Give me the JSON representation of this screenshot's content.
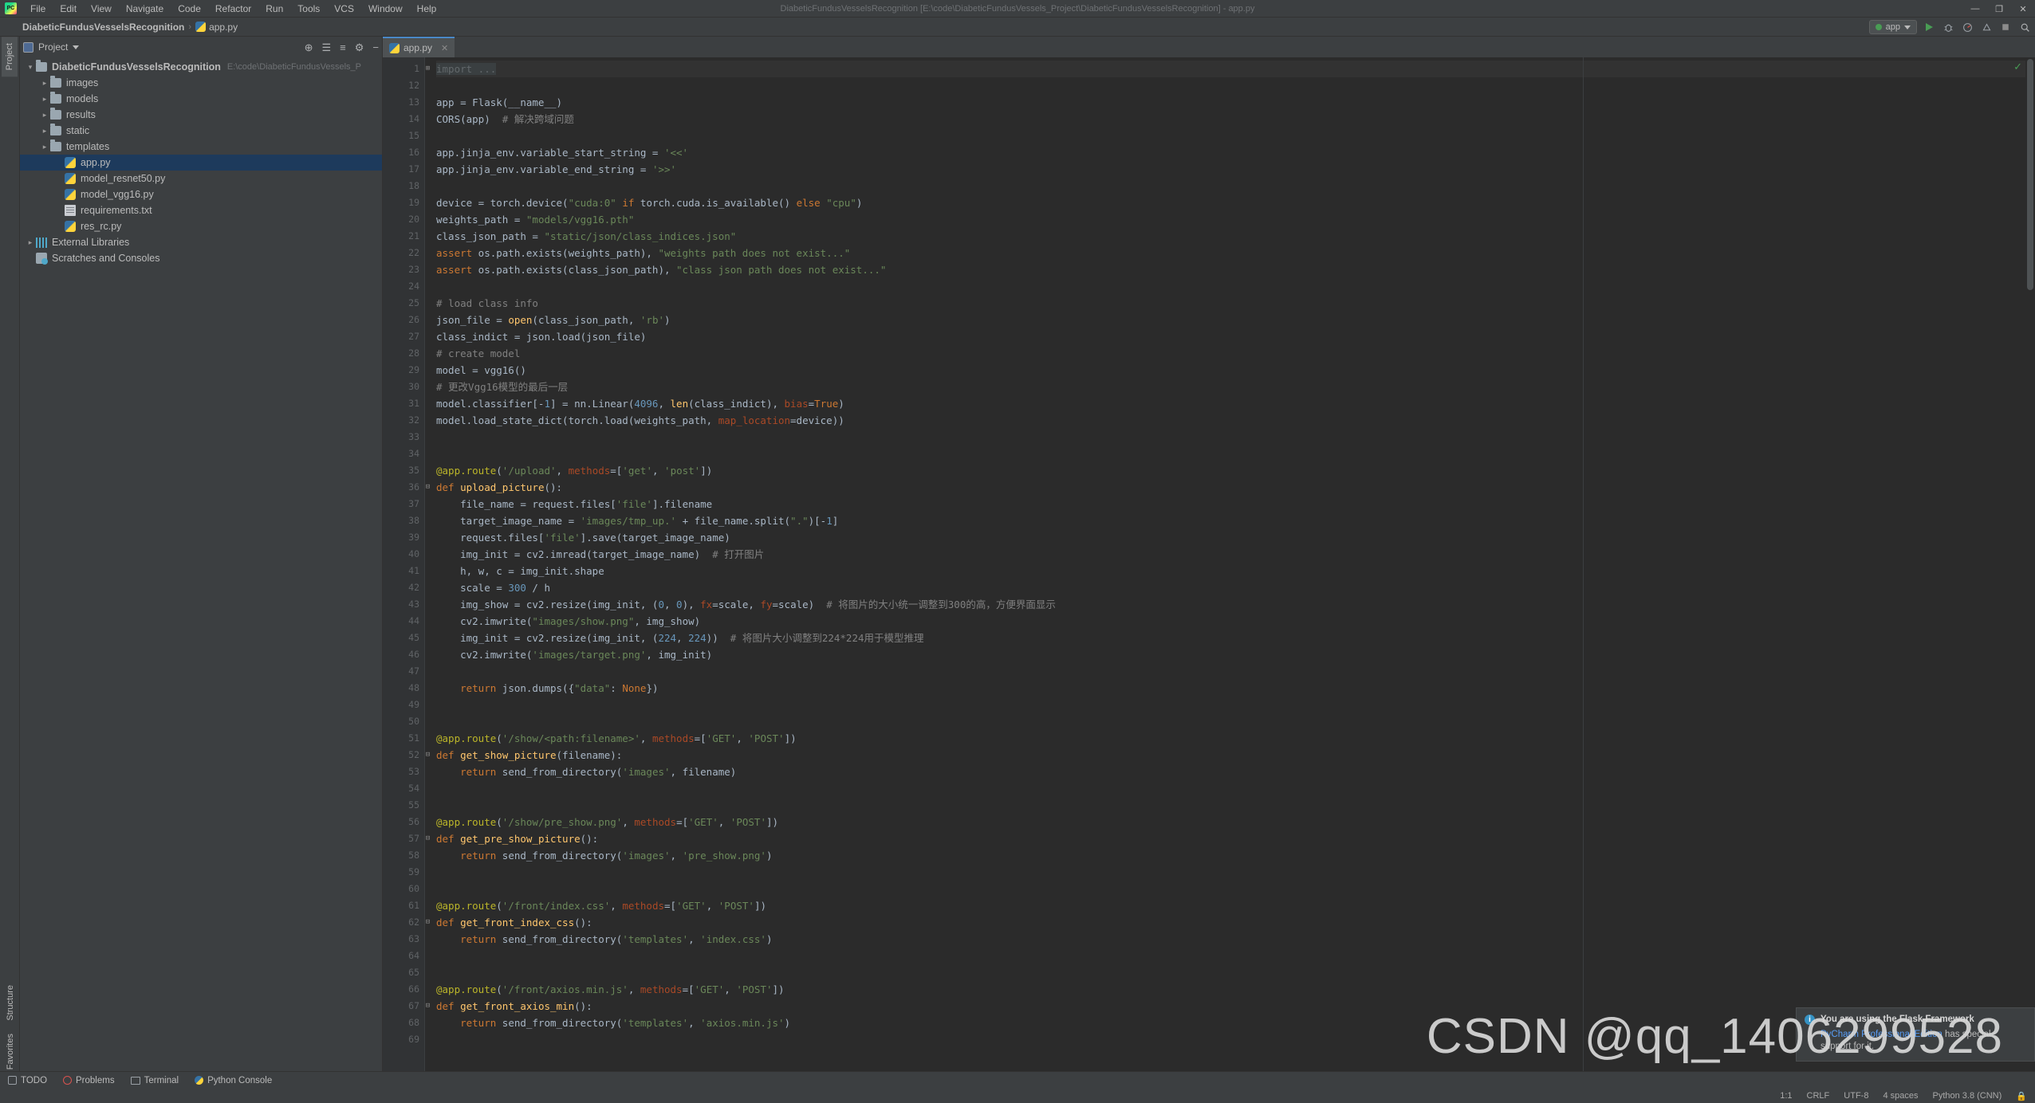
{
  "window": {
    "title": "DiabeticFundusVesselsRecognition [E:\\code\\DiabeticFundusVessels_Project\\DiabeticFundusVesselsRecognition] - app.py",
    "minimize": "—",
    "maximize": "❐",
    "close": "✕"
  },
  "menubar": {
    "items": [
      "File",
      "Edit",
      "View",
      "Navigate",
      "Code",
      "Refactor",
      "Run",
      "Tools",
      "VCS",
      "Window",
      "Help"
    ]
  },
  "breadcrumb": {
    "project": "DiabeticFundusVesselsRecognition",
    "separator": "›",
    "file": "app.py"
  },
  "runwidget": {
    "config_name": "app",
    "run_icon": "run-icon",
    "debug_icon": "debug-icon",
    "profile_icon": "profile-icon",
    "coverage_icon": "coverage-icon",
    "stop_icon": "stop-icon",
    "search_icon": "search-icon"
  },
  "left_strip": {
    "project_tab": "Project",
    "structure_tab": "Structure",
    "favorites_tab": "Favorites"
  },
  "project_panel": {
    "title": "Project",
    "tools": [
      "⊕",
      "☰",
      "≡",
      "⚙",
      "−"
    ],
    "tree": [
      {
        "depth": 0,
        "arrow": "open",
        "icon": "folder",
        "label": "DiabeticFundusVesselsRecognition",
        "bold": true,
        "path": "E:\\code\\DiabeticFundusVessels_P",
        "selected": false
      },
      {
        "depth": 1,
        "arrow": "closed",
        "icon": "folder",
        "label": "images",
        "bold": false,
        "path": "",
        "selected": false
      },
      {
        "depth": 1,
        "arrow": "closed",
        "icon": "folder",
        "label": "models",
        "bold": false,
        "path": "",
        "selected": false
      },
      {
        "depth": 1,
        "arrow": "closed",
        "icon": "folder",
        "label": "results",
        "bold": false,
        "path": "",
        "selected": false
      },
      {
        "depth": 1,
        "arrow": "closed",
        "icon": "folder",
        "label": "static",
        "bold": false,
        "path": "",
        "selected": false
      },
      {
        "depth": 1,
        "arrow": "closed",
        "icon": "folder",
        "label": "templates",
        "bold": false,
        "path": "",
        "selected": false
      },
      {
        "depth": 2,
        "arrow": "none",
        "icon": "py",
        "label": "app.py",
        "bold": false,
        "path": "",
        "selected": true
      },
      {
        "depth": 2,
        "arrow": "none",
        "icon": "py",
        "label": "model_resnet50.py",
        "bold": false,
        "path": "",
        "selected": false
      },
      {
        "depth": 2,
        "arrow": "none",
        "icon": "py",
        "label": "model_vgg16.py",
        "bold": false,
        "path": "",
        "selected": false
      },
      {
        "depth": 2,
        "arrow": "none",
        "icon": "txt",
        "label": "requirements.txt",
        "bold": false,
        "path": "",
        "selected": false
      },
      {
        "depth": 2,
        "arrow": "none",
        "icon": "py",
        "label": "res_rc.py",
        "bold": false,
        "path": "",
        "selected": false
      },
      {
        "depth": 0,
        "arrow": "closed",
        "icon": "lib",
        "label": "External Libraries",
        "bold": false,
        "path": "",
        "selected": false
      },
      {
        "depth": 0,
        "arrow": "none",
        "icon": "scratch",
        "label": "Scratches and Consoles",
        "bold": false,
        "path": "",
        "selected": false
      }
    ]
  },
  "editor": {
    "tab_label": "app.py",
    "tab_close": "✕",
    "first_line_number": 1,
    "lines": [
      {
        "n": 1,
        "fold": "+",
        "html": "<span class=\"fold-text\">import ...</span>"
      },
      {
        "n": 12,
        "fold": "",
        "html": ""
      },
      {
        "n": 13,
        "fold": "",
        "html": "app = Flask(__name__)"
      },
      {
        "n": 14,
        "fold": "",
        "html": "CORS(app)  <span class=\"cmt\"># 解决跨域问题</span>"
      },
      {
        "n": 15,
        "fold": "",
        "html": ""
      },
      {
        "n": 16,
        "fold": "",
        "html": "app.jinja_env.variable_start_string = <span class=\"str\">'&lt;&lt;'</span>"
      },
      {
        "n": 17,
        "fold": "",
        "html": "app.jinja_env.variable_end_string = <span class=\"str\">'&gt;&gt;'</span>"
      },
      {
        "n": 18,
        "fold": "",
        "html": ""
      },
      {
        "n": 19,
        "fold": "",
        "html": "device = torch.device(<span class=\"str\">\"cuda:0\"</span> <span class=\"kw\">if</span> torch.cuda.is_available() <span class=\"kw\">else</span> <span class=\"str\">\"cpu\"</span>)"
      },
      {
        "n": 20,
        "fold": "",
        "html": "weights_path = <span class=\"str\">\"models/vgg16.pth\"</span>"
      },
      {
        "n": 21,
        "fold": "",
        "html": "class_json_path = <span class=\"str\">\"static/json/class_indices.json\"</span>"
      },
      {
        "n": 22,
        "fold": "",
        "html": "<span class=\"kw\">assert</span> os.path.exists(weights_path), <span class=\"str\">\"weights path does not exist...\"</span>"
      },
      {
        "n": 23,
        "fold": "",
        "html": "<span class=\"kw\">assert</span> os.path.exists(class_json_path), <span class=\"str\">\"class json path does not exist...\"</span>"
      },
      {
        "n": 24,
        "fold": "",
        "html": ""
      },
      {
        "n": 25,
        "fold": "",
        "html": "<span class=\"cmt\"># load class info</span>"
      },
      {
        "n": 26,
        "fold": "",
        "html": "json_file = <span class=\"fn\">open</span>(class_json_path, <span class=\"str\">'rb'</span>)"
      },
      {
        "n": 27,
        "fold": "",
        "html": "class_indict = json.load(json_file)"
      },
      {
        "n": 28,
        "fold": "",
        "html": "<span class=\"cmt\"># create model</span>"
      },
      {
        "n": 29,
        "fold": "",
        "html": "model = vgg16()"
      },
      {
        "n": 30,
        "fold": "",
        "html": "<span class=\"cmt\"># 更改Vgg16模型的最后一层</span>"
      },
      {
        "n": 31,
        "fold": "",
        "html": "model.classifier[-<span class=\"num\">1</span>] = nn.Linear(<span class=\"num\">4096</span>, <span class=\"fn\">len</span>(class_indict), <span class=\"param\">bias</span>=<span class=\"kw\">True</span>)"
      },
      {
        "n": 32,
        "fold": "",
        "html": "model.load_state_dict(torch.load(weights_path, <span class=\"param\">map_location</span>=device))"
      },
      {
        "n": 33,
        "fold": "",
        "html": ""
      },
      {
        "n": 34,
        "fold": "",
        "html": ""
      },
      {
        "n": 35,
        "fold": "",
        "html": "<span class=\"dec\">@app.route</span>(<span class=\"str\">'/upload'</span>, <span class=\"param\">methods</span>=[<span class=\"str\">'get'</span>, <span class=\"str\">'post'</span>])"
      },
      {
        "n": 36,
        "fold": "-",
        "html": "<span class=\"kw\">def</span> <span class=\"fn\">upload_picture</span>():"
      },
      {
        "n": 37,
        "fold": "",
        "html": "    file_name = request.files[<span class=\"str\">'file'</span>].filename"
      },
      {
        "n": 38,
        "fold": "",
        "html": "    target_image_name = <span class=\"str\">'images/tmp_up.'</span> + file_name.split(<span class=\"str\">\".\"</span>)[-<span class=\"num\">1</span>]"
      },
      {
        "n": 39,
        "fold": "",
        "html": "    request.files[<span class=\"str\">'file'</span>].save(target_image_name)"
      },
      {
        "n": 40,
        "fold": "",
        "html": "    img_init = cv2.imread(target_image_name)  <span class=\"cmt\"># 打开图片</span>"
      },
      {
        "n": 41,
        "fold": "",
        "html": "    h, w, c = img_init.shape"
      },
      {
        "n": 42,
        "fold": "",
        "html": "    scale = <span class=\"num\">300</span> / h"
      },
      {
        "n": 43,
        "fold": "",
        "html": "    img_show = cv2.resize(img_init, (<span class=\"num\">0</span>, <span class=\"num\">0</span>), <span class=\"param\">fx</span>=scale, <span class=\"param\">fy</span>=scale)  <span class=\"cmt\"># 将图片的大小统一调整到300的高，方便界面显示</span>"
      },
      {
        "n": 44,
        "fold": "",
        "html": "    cv2.imwrite(<span class=\"str\">\"images/show.png\"</span>, img_show)"
      },
      {
        "n": 45,
        "fold": "",
        "html": "    img_init = cv2.resize(img_init, (<span class=\"num\">224</span>, <span class=\"num\">224</span>))  <span class=\"cmt\"># 将图片大小调整到224*224用于模型推理</span>"
      },
      {
        "n": 46,
        "fold": "",
        "html": "    cv2.imwrite(<span class=\"str\">'images/target.png'</span>, img_init)"
      },
      {
        "n": 47,
        "fold": "",
        "html": ""
      },
      {
        "n": 48,
        "fold": "",
        "html": "    <span class=\"kw\">return</span> json.dumps({<span class=\"str\">\"data\"</span>: <span class=\"kw\">None</span>})"
      },
      {
        "n": 49,
        "fold": "",
        "html": ""
      },
      {
        "n": 50,
        "fold": "",
        "html": ""
      },
      {
        "n": 51,
        "fold": "",
        "html": "<span class=\"dec\">@app.route</span>(<span class=\"str\">'/show/&lt;path:filename&gt;'</span>, <span class=\"param\">methods</span>=[<span class=\"str\">'GET'</span>, <span class=\"str\">'POST'</span>])"
      },
      {
        "n": 52,
        "fold": "-",
        "html": "<span class=\"kw\">def</span> <span class=\"fn\">get_show_picture</span>(filename):"
      },
      {
        "n": 53,
        "fold": "",
        "html": "    <span class=\"kw\">return</span> send_from_directory(<span class=\"str\">'images'</span>, filename)"
      },
      {
        "n": 54,
        "fold": "",
        "html": ""
      },
      {
        "n": 55,
        "fold": "",
        "html": ""
      },
      {
        "n": 56,
        "fold": "",
        "html": "<span class=\"dec\">@app.route</span>(<span class=\"str\">'/show/pre_show.png'</span>, <span class=\"param\">methods</span>=[<span class=\"str\">'GET'</span>, <span class=\"str\">'POST'</span>])"
      },
      {
        "n": 57,
        "fold": "-",
        "html": "<span class=\"kw\">def</span> <span class=\"fn\">get_pre_show_picture</span>():"
      },
      {
        "n": 58,
        "fold": "",
        "html": "    <span class=\"kw\">return</span> send_from_directory(<span class=\"str\">'images'</span>, <span class=\"str\">'pre_show.png'</span>)"
      },
      {
        "n": 59,
        "fold": "",
        "html": ""
      },
      {
        "n": 60,
        "fold": "",
        "html": ""
      },
      {
        "n": 61,
        "fold": "",
        "html": "<span class=\"dec\">@app.route</span>(<span class=\"str\">'/front/index.css'</span>, <span class=\"param\">methods</span>=[<span class=\"str\">'GET'</span>, <span class=\"str\">'POST'</span>])"
      },
      {
        "n": 62,
        "fold": "-",
        "html": "<span class=\"kw\">def</span> <span class=\"fn\">get_front_index_css</span>():"
      },
      {
        "n": 63,
        "fold": "",
        "html": "    <span class=\"kw\">return</span> send_from_directory(<span class=\"str\">'templates'</span>, <span class=\"str\">'index.css'</span>)"
      },
      {
        "n": 64,
        "fold": "",
        "html": ""
      },
      {
        "n": 65,
        "fold": "",
        "html": ""
      },
      {
        "n": 66,
        "fold": "",
        "html": "<span class=\"dec\">@app.route</span>(<span class=\"str\">'/front/axios.min.js'</span>, <span class=\"param\">methods</span>=[<span class=\"str\">'GET'</span>, <span class=\"str\">'POST'</span>])"
      },
      {
        "n": 67,
        "fold": "-",
        "html": "<span class=\"kw\">def</span> <span class=\"fn\">get_front_axios_min</span>():"
      },
      {
        "n": 68,
        "fold": "",
        "html": "    <span class=\"kw\">return</span> send_from_directory(<span class=\"str\">'templates'</span>, <span class=\"str\">'axios.min.js'</span>)"
      },
      {
        "n": 69,
        "fold": "",
        "html": ""
      }
    ]
  },
  "notification": {
    "title": "You are using the Flask Framework",
    "link": "PyCharm Professional Edition",
    "body_rest": " has special",
    "body_line2": "support for it."
  },
  "bottombar": {
    "items": [
      {
        "label": "TODO",
        "icon": "todo-icon"
      },
      {
        "label": "Problems",
        "icon": "problems-icon"
      },
      {
        "label": "Terminal",
        "icon": "terminal-icon"
      },
      {
        "label": "Python Console",
        "icon": "python-console-icon"
      }
    ]
  },
  "statusbar": {
    "left": "",
    "caret": "1:1",
    "line_sep": "CRLF",
    "encoding": "UTF-8",
    "indent": "4 spaces",
    "interpreter": "Python 3.8 (CNN)",
    "lock_icon": "lock-icon"
  },
  "watermark": "CSDN @qq_1406299528",
  "colors": {
    "accent": "#4a88c7",
    "selection": "#1d3a5c",
    "editor_bg": "#2b2b2b",
    "chrome_bg": "#3c3f41",
    "run_green": "#499c54"
  }
}
